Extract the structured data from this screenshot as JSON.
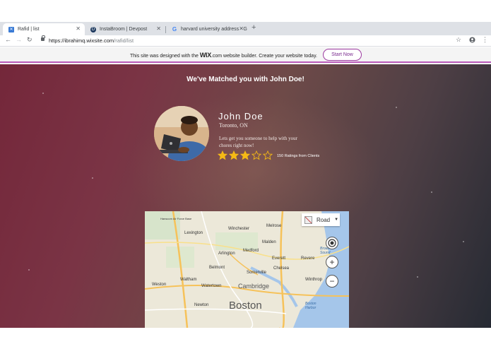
{
  "browser": {
    "tabs": [
      {
        "title": "Rafid | list",
        "favicon": "wix-favicon-icon"
      },
      {
        "title": "InstaBroom | Devpost",
        "favicon": "devpost-favicon-icon"
      },
      {
        "title": "harvard university address - G",
        "favicon": "google-favicon-icon"
      }
    ],
    "close_glyph": "✕",
    "new_tab_glyph": "+",
    "url_host": "https://ibrahimq.wixsite.com",
    "url_path": "/rafid/list"
  },
  "wix_banner": {
    "text_before": "This site was designed with the ",
    "brand": "WIX",
    "text_after": ".com website builder. Create your website today.",
    "button": "Start Now"
  },
  "match": {
    "title": "We've Matched you with John Doe!",
    "name": "John Doe",
    "location": "Toronto, ON",
    "description": "Lets get you someone to help with your chores right now!",
    "rating": 3,
    "rating_max": 5,
    "ratings_text": "150 Ratings from Clients"
  },
  "map": {
    "type_label": "Road",
    "labels": [
      "Lexington",
      "Winchester",
      "Melrose",
      "Malden",
      "Arlington",
      "Medford",
      "Everett",
      "Revere",
      "Belmont",
      "Somerville",
      "Chelsea",
      "Waltham",
      "Watertown",
      "Cambridge",
      "Weston",
      "Winthrop",
      "Newton",
      "Boston",
      "Broad Sound",
      "Boston Harbor",
      "Hanscom Air Force Base"
    ],
    "route_shields": [
      "2",
      "60",
      "3",
      "1",
      "93"
    ]
  },
  "colors": {
    "accent": "#b95ab9",
    "star": "#f5b915",
    "hero_left": "#74273a",
    "hero_right": "#262a33"
  }
}
